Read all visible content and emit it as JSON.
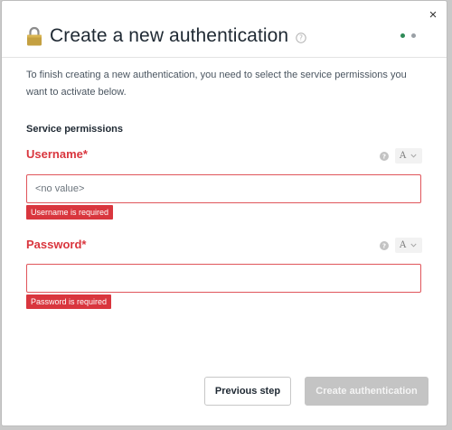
{
  "dialog": {
    "title": "Create a new authentication",
    "close_label": "×",
    "description": "To finish creating a new authentication, you need to select the service permissions you want to activate below.",
    "section_title": "Service permissions",
    "steps": [
      {
        "state": "current",
        "color": "#2e8b57"
      },
      {
        "state": "upcoming",
        "color": "#9aa0a6"
      }
    ]
  },
  "fields": {
    "username": {
      "label": "Username*",
      "type_value": "A",
      "value": "",
      "placeholder": "<no value>",
      "error": "Username is required"
    },
    "password": {
      "label": "Password*",
      "type_value": "A",
      "value": "",
      "placeholder": "",
      "error": "Password is required"
    }
  },
  "footer": {
    "previous_label": "Previous step",
    "create_label": "Create authentication",
    "create_disabled": true
  },
  "colors": {
    "error": "#d9363e",
    "step_active": "#2e8b57",
    "step_inactive": "#9aa0a6",
    "lock_body": "#c4a041",
    "disabled_button": "#c4c4c4"
  },
  "icons": [
    "lock-icon",
    "help-icon",
    "close-icon",
    "chevron-down-icon"
  ]
}
